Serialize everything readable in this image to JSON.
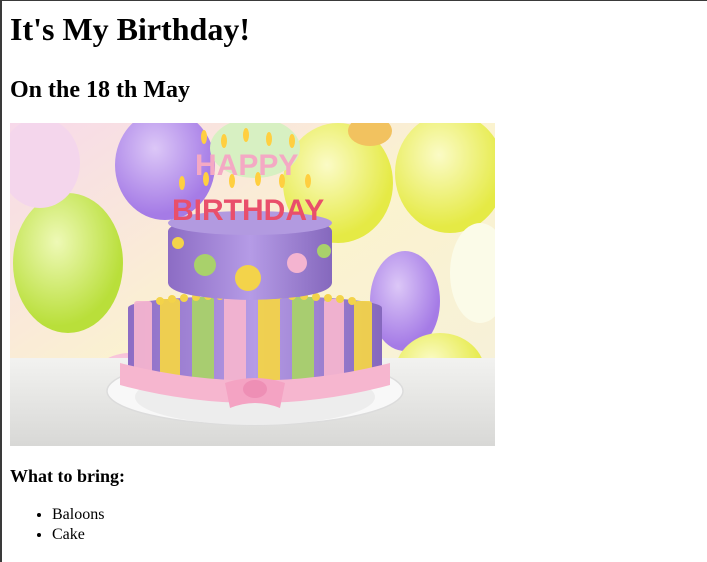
{
  "page": {
    "title": "It's My Birthday!",
    "date_heading": "On the 18 th May",
    "image": {
      "icon": "birthday-cake-photo",
      "cake_text_line1": "HAPPY",
      "cake_text_line2": "BIRTHDAY"
    },
    "bring_heading": "What to bring:",
    "bring_items": [
      "Baloons",
      "Cake"
    ]
  },
  "colors": {
    "text": "#000000",
    "background": "#ffffff",
    "cake_purple": "#9b7fd1",
    "cake_pink": "#f4a9c4",
    "cake_yellow": "#f3d34a",
    "cake_green": "#a9d16b"
  }
}
